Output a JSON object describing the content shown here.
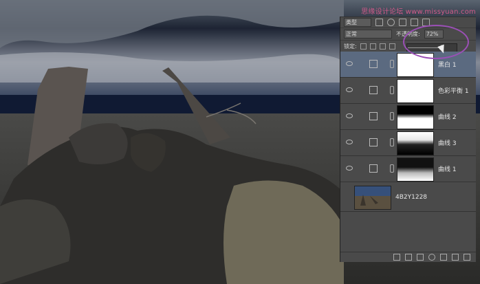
{
  "watermark": "思缘设计论坛 www.missyuan.com",
  "panel": {
    "kind_filter": "类型",
    "blend_mode": "正常",
    "opacity_label": "不透明度:",
    "opacity_value": "72%",
    "lock_label": "锁定:"
  },
  "opacity_slider": {
    "level": 0.72
  },
  "layers": [
    {
      "name": "黑白 1",
      "selected": true,
      "mask": "white"
    },
    {
      "name": "色彩平衡 1",
      "selected": false,
      "mask": "white"
    },
    {
      "name": "曲线 2",
      "selected": false,
      "mask": "curves2"
    },
    {
      "name": "曲线 3",
      "selected": false,
      "mask": "curves3"
    },
    {
      "name": "曲线 1",
      "selected": false,
      "mask": "curves1"
    }
  ],
  "background_layer": {
    "name": "4B2Y1228"
  },
  "colors": {
    "selected_layer": "#5b6a80",
    "highlight_ring": "#9b4fb6",
    "watermark": "#d15a8a"
  }
}
